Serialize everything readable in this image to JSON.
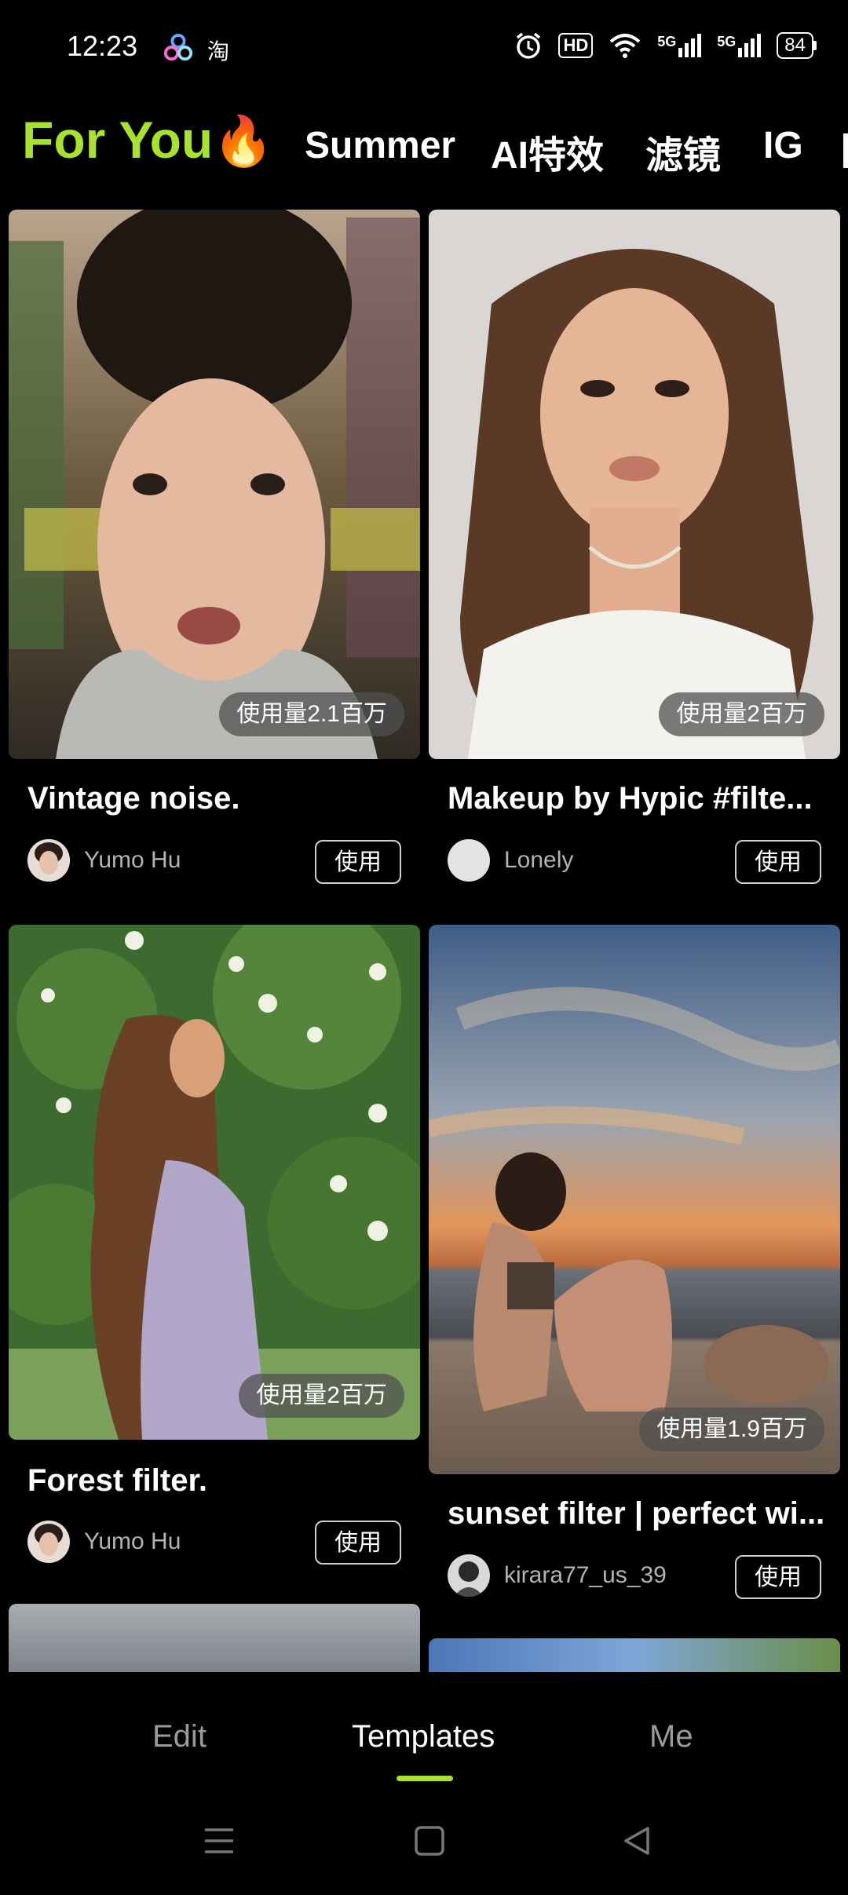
{
  "status_bar": {
    "time": "12:23",
    "taobao_glyph": "淘",
    "hd_label": "HD",
    "net1": "5G",
    "net2": "5G",
    "battery": "84"
  },
  "top_tabs": [
    {
      "label": "For You",
      "active": true
    },
    {
      "label": "Summer"
    },
    {
      "label": "AI特效"
    },
    {
      "label": "滤镜"
    },
    {
      "label": "IG"
    }
  ],
  "cards": [
    {
      "usage": "使用量2.1百万",
      "title": "Vintage noise.",
      "author": "Yumo Hu",
      "button": "使用"
    },
    {
      "usage": "使用量2百万",
      "title": "Makeup by Hypic #filte...",
      "author": "Lonely",
      "button": "使用"
    },
    {
      "usage": "使用量2百万",
      "title": "Forest filter.",
      "author": "Yumo Hu",
      "button": "使用"
    },
    {
      "usage": "使用量1.9百万",
      "title": "sunset filter | perfect wi...",
      "author": "kirara77_us_39",
      "button": "使用"
    }
  ],
  "bottom_nav": [
    {
      "label": "Edit"
    },
    {
      "label": "Templates",
      "active": true
    },
    {
      "label": "Me"
    }
  ],
  "colors": {
    "accent": "#a6e22e",
    "background": "#000000"
  }
}
